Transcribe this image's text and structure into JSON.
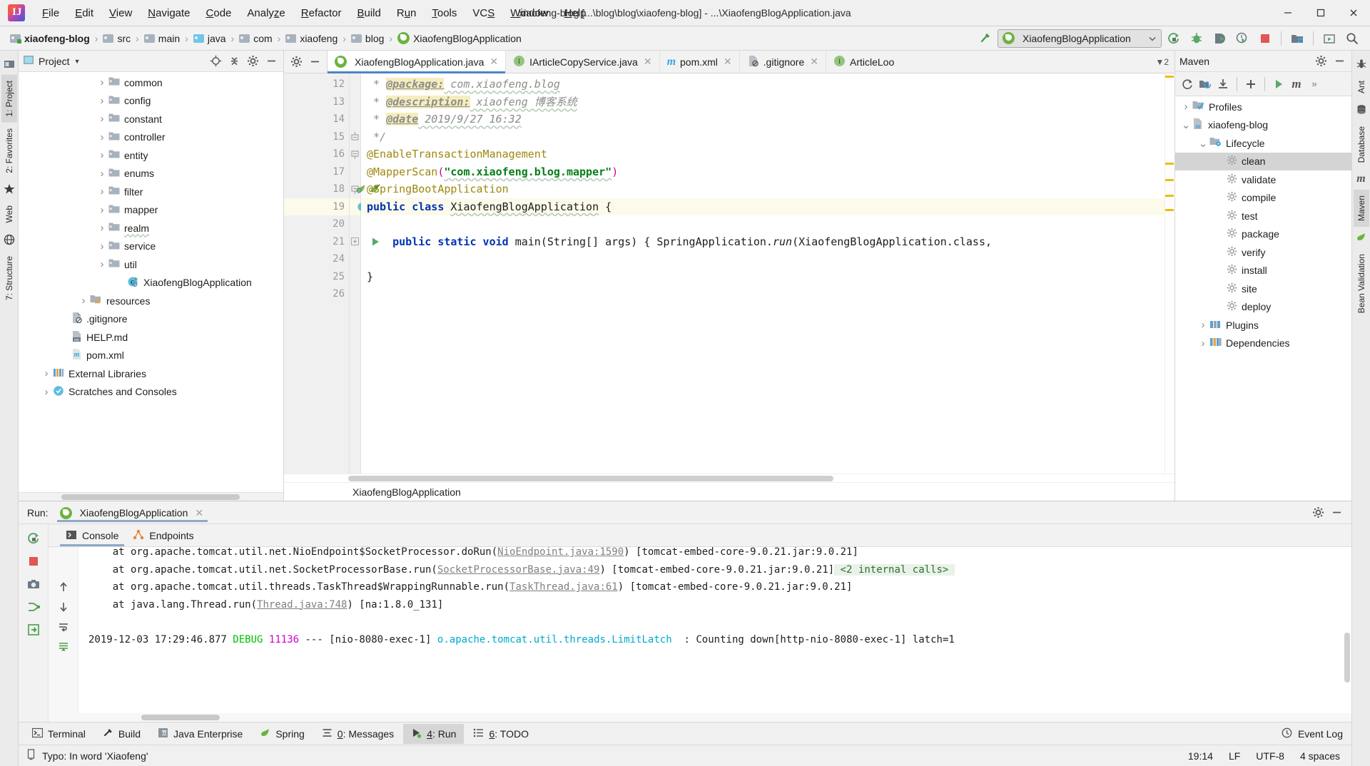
{
  "window": {
    "title": "xiaofeng-blog [...\\blog\\blog\\xiaofeng-blog] - ...\\XiaofengBlogApplication.java",
    "minimize": "—",
    "maximize": "❐",
    "close": "✕"
  },
  "menu": [
    {
      "label": "File"
    },
    {
      "label": "Edit"
    },
    {
      "label": "View"
    },
    {
      "label": "Navigate"
    },
    {
      "label": "Code"
    },
    {
      "label": "Analyze"
    },
    {
      "label": "Refactor"
    },
    {
      "label": "Build"
    },
    {
      "label": "Run"
    },
    {
      "label": "Tools"
    },
    {
      "label": "VCS"
    },
    {
      "label": "Window"
    },
    {
      "label": "Help"
    }
  ],
  "navbar": {
    "crumbs": [
      {
        "label": "xiaofeng-blog",
        "icon": "module-icon"
      },
      {
        "label": "src",
        "icon": "folder-icon"
      },
      {
        "label": "main",
        "icon": "folder-icon"
      },
      {
        "label": "java",
        "icon": "source-root-icon"
      },
      {
        "label": "com",
        "icon": "package-icon"
      },
      {
        "label": "xiaofeng",
        "icon": "package-icon"
      },
      {
        "label": "blog",
        "icon": "package-icon"
      },
      {
        "label": "XiaofengBlogApplication",
        "icon": "spring-class-icon"
      }
    ],
    "separator": "›",
    "run_config": "XiaofengBlogApplication",
    "toolbar_icons": [
      "run-icon",
      "debug-icon",
      "run-with-coverage-icon",
      "profiler-icon",
      "stop-icon",
      "project-structure-icon",
      "update-project-icon",
      "search-everywhere-icon"
    ]
  },
  "left_strip": [
    {
      "label": "1: Project",
      "selected": true
    },
    {
      "label": "2: Favorites",
      "selected": false
    },
    {
      "label": "Web",
      "selected": false
    },
    {
      "label": "7: Structure",
      "selected": false
    }
  ],
  "right_strip": [
    {
      "label": "Ant"
    },
    {
      "label": "Database"
    },
    {
      "label": "Maven",
      "selected": true
    },
    {
      "label": "Bean Validation"
    }
  ],
  "project_panel": {
    "title": "Project",
    "dropdown": "▼",
    "actions": [
      "locate-icon",
      "collapse-all-icon",
      "settings-icon",
      "hide-icon"
    ],
    "tree": [
      {
        "label": "common",
        "depth": 4,
        "arrow": true,
        "icon": "package-icon"
      },
      {
        "label": "config",
        "depth": 4,
        "arrow": true,
        "icon": "package-icon"
      },
      {
        "label": "constant",
        "depth": 4,
        "arrow": true,
        "icon": "package-icon"
      },
      {
        "label": "controller",
        "depth": 4,
        "arrow": true,
        "icon": "package-icon"
      },
      {
        "label": "entity",
        "depth": 4,
        "arrow": true,
        "icon": "package-icon"
      },
      {
        "label": "enums",
        "depth": 4,
        "arrow": true,
        "icon": "package-icon"
      },
      {
        "label": "filter",
        "depth": 4,
        "arrow": true,
        "icon": "package-icon"
      },
      {
        "label": "mapper",
        "depth": 4,
        "arrow": true,
        "icon": "package-icon"
      },
      {
        "label": "realm",
        "depth": 4,
        "arrow": true,
        "icon": "package-icon",
        "typo": true
      },
      {
        "label": "service",
        "depth": 4,
        "arrow": true,
        "icon": "package-icon"
      },
      {
        "label": "util",
        "depth": 4,
        "arrow": true,
        "icon": "package-icon"
      },
      {
        "label": "XiaofengBlogApplication",
        "depth": 5,
        "arrow": false,
        "icon": "spring-class-icon"
      },
      {
        "label": "resources",
        "depth": 3,
        "arrow": true,
        "icon": "resource-root-icon"
      },
      {
        "label": ".gitignore",
        "depth": 2,
        "arrow": false,
        "icon": "gitignore-icon"
      },
      {
        "label": "HELP.md",
        "depth": 2,
        "arrow": false,
        "icon": "markdown-icon"
      },
      {
        "label": "pom.xml",
        "depth": 2,
        "arrow": false,
        "icon": "maven-icon"
      },
      {
        "label": "External Libraries",
        "depth": 1,
        "arrow": true,
        "icon": "libraries-icon"
      },
      {
        "label": "Scratches and Consoles",
        "depth": 1,
        "arrow": true,
        "icon": "scratches-icon"
      }
    ]
  },
  "editor": {
    "tabs": [
      {
        "label": "XiaofengBlogApplication.java",
        "icon": "spring-class-icon",
        "active": true,
        "closable": true
      },
      {
        "label": "IArticleCopyService.java",
        "icon": "interface-icon",
        "active": false,
        "closable": true
      },
      {
        "label": "pom.xml",
        "icon": "maven-icon",
        "active": false,
        "closable": true
      },
      {
        "label": ".gitignore",
        "icon": "gitignore-icon",
        "active": false,
        "closable": true
      },
      {
        "label": "ArticleLoo",
        "icon": "interface-icon",
        "active": false,
        "closable": false
      }
    ],
    "tab_overflow": "▼2",
    "breadcrumb": "XiaofengBlogApplication",
    "first_line_number": 12,
    "lines": [
      {
        "n": "12",
        "kind": "comment_tag",
        "tag": " * ",
        "name": "@package:",
        "rest": " com.xiaofeng.blog"
      },
      {
        "n": "13",
        "kind": "comment_tag",
        "tag": " * ",
        "name": "@description:",
        "rest": " xiaofeng 博客系统"
      },
      {
        "n": "14",
        "kind": "comment_tag",
        "tag": " * ",
        "name": "@date",
        "rest": " 2019/9/27 16:32"
      },
      {
        "n": "15",
        "kind": "comment_end",
        "text": " */",
        "fold": true
      },
      {
        "n": "16",
        "kind": "annotation",
        "text": "@EnableTransactionManagement",
        "fold": true
      },
      {
        "n": "17",
        "kind": "mapperscan",
        "anno": "@MapperScan",
        "open": "(",
        "str": "\"com.xiaofeng.blog.mapper\"",
        "close": ")"
      },
      {
        "n": "18",
        "kind": "annotation",
        "text": "@SpringBootApplication",
        "gutter_icons": [
          "bean-icon",
          "spring-config-icon"
        ],
        "fold": true
      },
      {
        "n": "19",
        "kind": "classdecl",
        "kw": "public class ",
        "name": "XiaofengBlogApplication",
        "brace": " {",
        "gutter_icons": [
          "spring-bean-icon",
          "run-icon"
        ],
        "highlighted": true
      },
      {
        "n": "20",
        "kind": "blank"
      },
      {
        "n": "21",
        "kind": "maindecl",
        "kw1": "    public static void ",
        "name": "main",
        "sig": "(String[] args) { ",
        "body": "SpringApplication.",
        "call": "run",
        "args": "(XiaofengBlogApplication.class,",
        "gutter_icons": [
          "run-icon"
        ],
        "fold": true
      },
      {
        "n": "24",
        "kind": "blank"
      },
      {
        "n": "25",
        "kind": "closebrace",
        "text": "}"
      },
      {
        "n": "26",
        "kind": "blank"
      }
    ]
  },
  "maven_panel": {
    "title": "Maven",
    "actions": [
      "settings-icon",
      "hide-icon"
    ],
    "toolbar_icons": [
      "reimport-icon",
      "generate-sources-icon",
      "download-sources-icon",
      "add-maven-project-icon",
      "run-maven-build-icon",
      "execute-goal-icon",
      "more-icon"
    ],
    "tree": [
      {
        "label": "Profiles",
        "depth": 0,
        "arrow": "›",
        "icon": "profiles-icon"
      },
      {
        "label": "xiaofeng-blog",
        "depth": 0,
        "arrow": "⌄",
        "icon": "maven-project-icon"
      },
      {
        "label": "Lifecycle",
        "depth": 1,
        "arrow": "⌄",
        "icon": "lifecycle-icon"
      },
      {
        "label": "clean",
        "depth": 2,
        "arrow": "",
        "icon": "goal-icon",
        "selected": true
      },
      {
        "label": "validate",
        "depth": 2,
        "arrow": "",
        "icon": "goal-icon"
      },
      {
        "label": "compile",
        "depth": 2,
        "arrow": "",
        "icon": "goal-icon"
      },
      {
        "label": "test",
        "depth": 2,
        "arrow": "",
        "icon": "goal-icon"
      },
      {
        "label": "package",
        "depth": 2,
        "arrow": "",
        "icon": "goal-icon"
      },
      {
        "label": "verify",
        "depth": 2,
        "arrow": "",
        "icon": "goal-icon"
      },
      {
        "label": "install",
        "depth": 2,
        "arrow": "",
        "icon": "goal-icon"
      },
      {
        "label": "site",
        "depth": 2,
        "arrow": "",
        "icon": "goal-icon"
      },
      {
        "label": "deploy",
        "depth": 2,
        "arrow": "",
        "icon": "goal-icon"
      },
      {
        "label": "Plugins",
        "depth": 1,
        "arrow": "›",
        "icon": "plugins-icon"
      },
      {
        "label": "Dependencies",
        "depth": 1,
        "arrow": "›",
        "icon": "dependencies-icon"
      }
    ]
  },
  "run_panel": {
    "label": "Run:",
    "tab": "XiaofengBlogApplication",
    "console_tabs": [
      {
        "label": "Console",
        "icon": "console-icon",
        "active": true
      },
      {
        "label": "Endpoints",
        "icon": "endpoints-icon",
        "active": false
      }
    ],
    "sidebar_icons": [
      "rerun-icon",
      "stop-icon",
      "camera-icon",
      "thread-dump-icon",
      "print-icon",
      "export-icon"
    ],
    "nav_icons": [
      "up-arrow-icon",
      "down-arrow-icon",
      "soft-wrap-icon",
      "scroll-to-end-icon"
    ],
    "console_lines": [
      {
        "type": "stack",
        "prefix": "    at org.apache.tomcat.util.net.NioEndpoint$SocketProcessor.doRun(",
        "link": "NioEndpoint.java:1590",
        "suffix": ") [tomcat-embed-core-9.0.21.jar:9.0.21]",
        "clipped": true
      },
      {
        "type": "stack",
        "prefix": "    at org.apache.tomcat.util.net.SocketProcessorBase.run(",
        "link": "SocketProcessorBase.java:49",
        "suffix": ") [tomcat-embed-core-9.0.21.jar:9.0.21]",
        "badge": "<2 internal calls>"
      },
      {
        "type": "stack",
        "prefix": "    at org.apache.tomcat.util.threads.TaskThread$WrappingRunnable.run(",
        "link": "TaskThread.java:61",
        "suffix": ") [tomcat-embed-core-9.0.21.jar:9.0.21]"
      },
      {
        "type": "stack",
        "prefix": "    at java.lang.Thread.run(",
        "link": "Thread.java:748",
        "suffix": ") [na:1.8.0_131]"
      },
      {
        "type": "blank"
      },
      {
        "type": "log",
        "timestamp": "2019-12-03 17:29:46.877",
        "level": "DEBUG",
        "pid": "11136",
        "sep": " --- ",
        "thread": "[nio-8080-exec-1] ",
        "logger": "o.apache.tomcat.util.threads.LimitLatch",
        "message": "  : Counting down[http-nio-8080-exec-1] latch=1"
      }
    ]
  },
  "toolwindow_bar": [
    {
      "label": "Terminal",
      "icon": "terminal-icon",
      "selected": false
    },
    {
      "label": "Build",
      "icon": "build-icon",
      "selected": false
    },
    {
      "label": "Java Enterprise",
      "icon": "java-ee-icon",
      "selected": false
    },
    {
      "label": "Spring",
      "icon": "spring-icon",
      "selected": false
    },
    {
      "label": "0: Messages",
      "icon": "messages-icon",
      "selected": false
    },
    {
      "label": "4: Run",
      "icon": "run-icon",
      "selected": true
    },
    {
      "label": "6: TODO",
      "icon": "todo-icon",
      "selected": false
    }
  ],
  "event_log": "Event Log",
  "statusbar": {
    "message": "Typo: In word 'Xiaofeng'",
    "icon": "inspection-icon",
    "position": "19:14",
    "line_separator": "LF",
    "encoding": "UTF-8",
    "indent": "4 spaces"
  }
}
